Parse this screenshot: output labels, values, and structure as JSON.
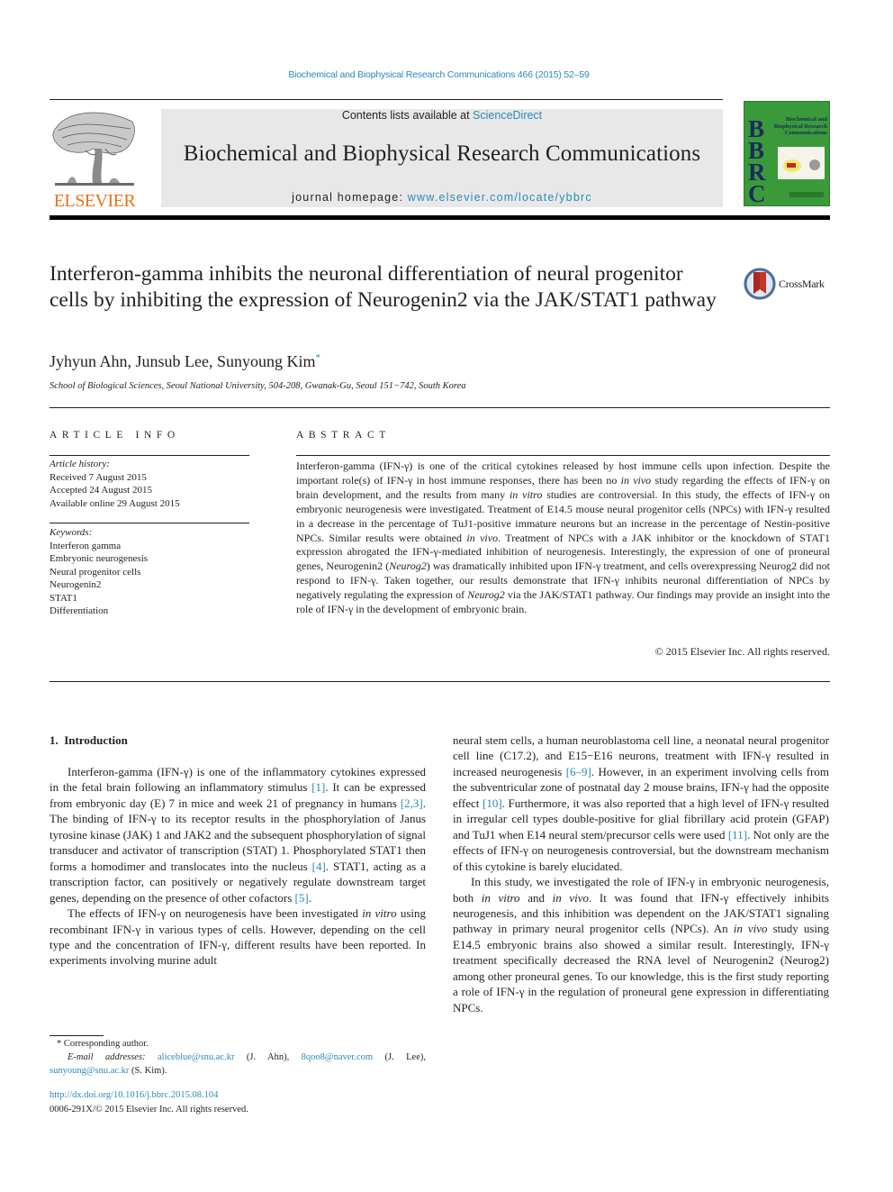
{
  "header": {
    "citation": "Biochemical and Biophysical Research Communications 466 (2015) 52–59",
    "publisher_logo_text": "ELSEVIER",
    "contents_prefix": "Contents lists available at ",
    "contents_link": "ScienceDirect",
    "journal_title": "Biochemical and Biophysical Research Communications",
    "homepage_prefix": "journal homepage: ",
    "homepage_link": "www.elsevier.com/locate/ybbrc",
    "cover_letters": "B\nB\nR\nC",
    "cover_title": "Biochemical and Biophysical Research Communications"
  },
  "article": {
    "title": "Interferon-gamma inhibits the neuronal differentiation of neural progenitor cells by inhibiting the expression of Neurogenin2 via the JAK/STAT1 pathway",
    "crossmark_label": "CrossMark",
    "authors": "Jyhyun Ahn, Junsub Lee, Sunyoung Kim",
    "corresponding_mark": "*",
    "affiliation": "School of Biological Sciences, Seoul National University, 504-208, Gwanak-Gu, Seoul 151−742, South Korea"
  },
  "article_info": {
    "heading": "ARTICLE INFO",
    "history_label": "Article history:",
    "history": [
      "Received 7 August 2015",
      "Accepted 24 August 2015",
      "Available online 29 August 2015"
    ],
    "keywords_label": "Keywords:",
    "keywords": [
      "Interferon gamma",
      "Embryonic neurogenesis",
      "Neural progenitor cells",
      "Neurogenin2",
      "STAT1",
      "Differentiation"
    ]
  },
  "abstract": {
    "heading": "ABSTRACT",
    "parts": [
      {
        "t": "Interferon-gamma (IFN-γ) is one of the critical cytokines released by host immune cells upon infection. Despite the important role(s) of IFN-γ in host immune responses, there has been no "
      },
      {
        "t": "in vivo",
        "i": true
      },
      {
        "t": " study regarding the effects of IFN-γ on brain development, and the results from many "
      },
      {
        "t": "in vitro",
        "i": true
      },
      {
        "t": " studies are controversial. In this study, the effects of IFN-γ on embryonic neurogenesis were investigated. Treatment of E14.5 mouse neural progenitor cells (NPCs) with IFN-γ resulted in a decrease in the percentage of TuJ1-positive immature neurons but an increase in the percentage of Nestin-positive NPCs. Similar results were obtained "
      },
      {
        "t": "in vivo",
        "i": true
      },
      {
        "t": ". Treatment of NPCs with a JAK inhibitor or the knockdown of STAT1 expression abrogated the IFN-γ-mediated inhibition of neurogenesis. Interestingly, the expression of one of proneural genes, Neurogenin2 ("
      },
      {
        "t": "Neurog2",
        "i": true
      },
      {
        "t": ") was dramatically inhibited upon IFN-γ treatment, and cells overexpressing Neurog2 did not respond to IFN-γ. Taken together, our results demonstrate that IFN-γ inhibits neuronal differentiation of NPCs by negatively regulating the expression of "
      },
      {
        "t": "Neurog2",
        "i": true
      },
      {
        "t": " via the JAK/STAT1 pathway. Our findings may provide an insight into the role of IFN-γ in the development of embryonic brain."
      }
    ],
    "copyright": "© 2015 Elsevier Inc. All rights reserved."
  },
  "introduction": {
    "heading": "1.  Introduction",
    "left_paragraphs": [
      [
        {
          "t": "Interferon-gamma (IFN-γ) is one of the inflammatory cytokines expressed in the fetal brain following an inflammatory stimulus "
        },
        {
          "t": "[1]",
          "ref": true
        },
        {
          "t": ". It can be expressed from embryonic day (E) 7 in mice and week 21 of pregnancy in humans "
        },
        {
          "t": "[2,3]",
          "ref": true
        },
        {
          "t": ". The binding of IFN-γ to its receptor results in the phosphorylation of Janus tyrosine kinase (JAK) 1 and JAK2 and the subsequent phosphorylation of signal transducer and activator of transcription (STAT) 1. Phosphorylated STAT1 then forms a homodimer and translocates into the nucleus "
        },
        {
          "t": "[4]",
          "ref": true
        },
        {
          "t": ". STAT1, acting as a transcription factor, can positively or negatively regulate downstream target genes, depending on the presence of other cofactors "
        },
        {
          "t": "[5]",
          "ref": true
        },
        {
          "t": "."
        }
      ],
      [
        {
          "t": "The effects of IFN-γ on neurogenesis have been investigated "
        },
        {
          "t": "in vitro",
          "i": true
        },
        {
          "t": " using recombinant IFN-γ in various types of cells. However, depending on the cell type and the concentration of IFN-γ, different results have been reported. In experiments involving murine adult"
        }
      ]
    ],
    "right_paragraphs": [
      [
        {
          "t": "neural stem cells, a human neuroblastoma cell line, a neonatal neural progenitor cell line (C17.2), and E15−E16 neurons, treatment with IFN-γ resulted in increased neurogenesis "
        },
        {
          "t": "[6–9]",
          "ref": true
        },
        {
          "t": ". However, in an experiment involving cells from the subventricular zone of postnatal day 2 mouse brains, IFN-γ had the opposite effect "
        },
        {
          "t": "[10]",
          "ref": true
        },
        {
          "t": ". Furthermore, it was also reported that a high level of IFN-γ resulted in irregular cell types double-positive for glial fibrillary acid protein (GFAP) and TuJ1 when E14 neural stem/precursor cells were used "
        },
        {
          "t": "[11]",
          "ref": true
        },
        {
          "t": ". Not only are the effects of IFN-γ on neurogenesis controversial, but the downstream mechanism of this cytokine is barely elucidated."
        }
      ],
      [
        {
          "t": "In this study, we investigated the role of IFN-γ in embryonic neurogenesis, both "
        },
        {
          "t": "in vitro",
          "i": true
        },
        {
          "t": " and "
        },
        {
          "t": "in vivo",
          "i": true
        },
        {
          "t": ". It was found that IFN-γ effectively inhibits neurogenesis, and this inhibition was dependent on the JAK/STAT1 signaling pathway in primary neural progenitor cells (NPCs). An "
        },
        {
          "t": "in vivo",
          "i": true
        },
        {
          "t": " study using E14.5 embryonic brains also showed a similar result. Interestingly, IFN-γ treatment specifically decreased the RNA level of Neurogenin2 (Neurog2) among other proneural genes. To our knowledge, this is the first study reporting a role of IFN-γ in the regulation of proneural gene expression in differentiating NPCs."
        }
      ]
    ]
  },
  "footnotes": {
    "corresponding": "* Corresponding author.",
    "email_label": "E-mail addresses:",
    "emails": [
      {
        "address": "aliceblue@snu.ac.kr",
        "who": "(J. Ahn),"
      },
      {
        "address": "8qoo8@naver.com",
        "who": "(J. Lee),"
      },
      {
        "address": "sunyoung@snu.ac.kr",
        "who": "(S. Kim)."
      }
    ],
    "doi": "http://dx.doi.org/10.1016/j.bbrc.2015.08.104",
    "issn": "0006-291X/© 2015 Elsevier Inc. All rights reserved."
  },
  "colors": {
    "link": "#2a8ab8",
    "elsevier_orange": "#e9711c",
    "masthead_bg": "#e8e8e8",
    "cover_green": "#3a9a3a"
  }
}
